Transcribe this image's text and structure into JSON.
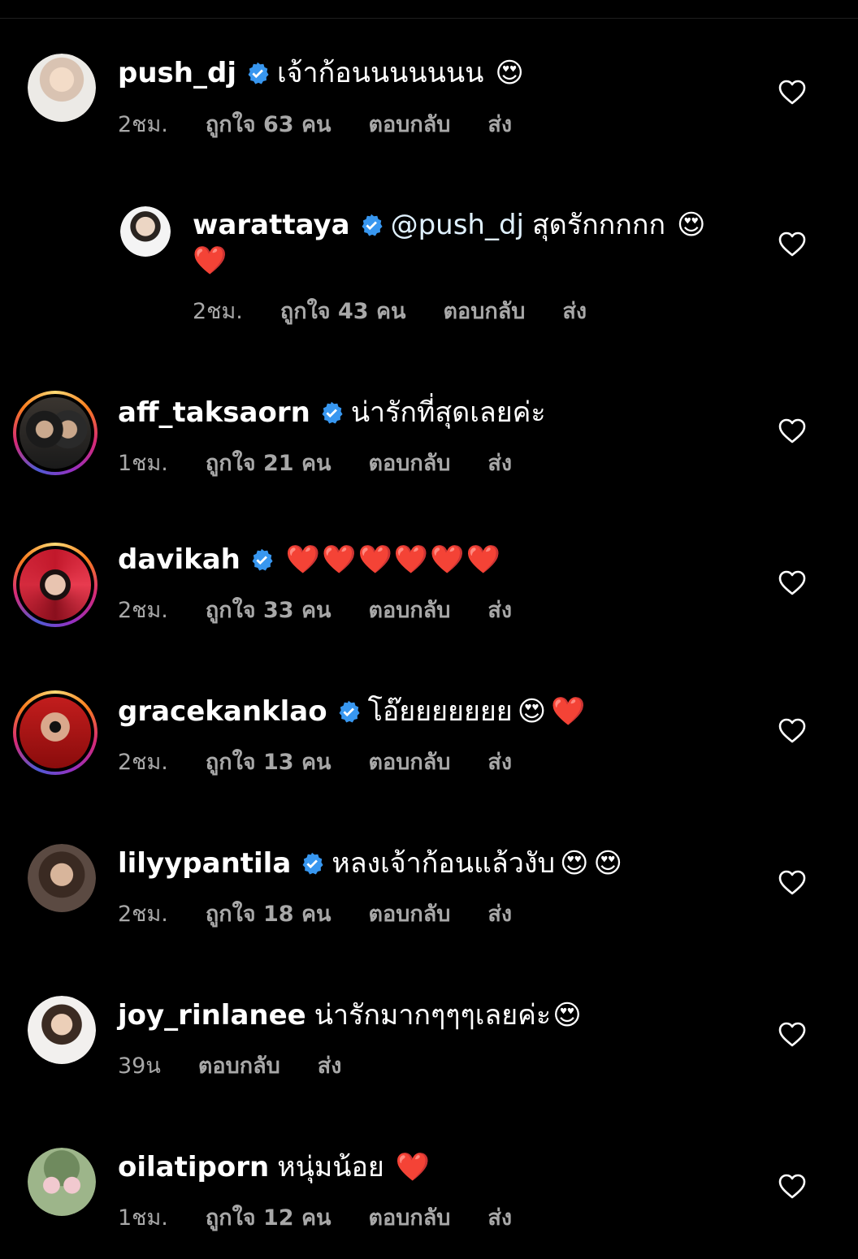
{
  "colors": {
    "background": "#000000",
    "text": "#ffffff",
    "muted": "#a8a8a8",
    "verified": "#3897f0"
  },
  "comments": [
    {
      "username": "push_dj",
      "verified": true,
      "text": "เจ้าก้อนนนนนนน",
      "emoji": "😍",
      "time": "2ชม.",
      "likes": "ถูกใจ 63 คน",
      "reply": "ตอบกลับ",
      "send": "ส่ง"
    },
    {
      "username": "warattaya",
      "verified": true,
      "mention": "@push_dj",
      "text": "สุดรักกกกก",
      "emoji": "😍",
      "emoji2": "❤️",
      "time": "2ชม.",
      "likes": "ถูกใจ 43 คน",
      "reply": "ตอบกลับ",
      "send": "ส่ง"
    },
    {
      "username": "aff_taksaorn",
      "verified": true,
      "text": "น่ารักที่สุดเลยค่ะ",
      "emoji": "",
      "time": "1ชม.",
      "likes": "ถูกใจ 21 คน",
      "reply": "ตอบกลับ",
      "send": "ส่ง"
    },
    {
      "username": "davikah",
      "verified": true,
      "text": "",
      "emoji": "❤️❤️❤️❤️❤️❤️",
      "time": "2ชม.",
      "likes": "ถูกใจ 33 คน",
      "reply": "ตอบกลับ",
      "send": "ส่ง"
    },
    {
      "username": "gracekanklao",
      "verified": true,
      "text": "โอ๊ยยยยยยย",
      "emoji": "😍❤️",
      "time": "2ชม.",
      "likes": "ถูกใจ 13 คน",
      "reply": "ตอบกลับ",
      "send": "ส่ง"
    },
    {
      "username": "lilyypantila",
      "verified": true,
      "text": "หลงเจ้าก้อนแล้วงับ",
      "emoji": "😍😍",
      "time": "2ชม.",
      "likes": "ถูกใจ 18 คน",
      "reply": "ตอบกลับ",
      "send": "ส่ง"
    },
    {
      "username": "joy_rinlanee",
      "verified": false,
      "text": "น่ารักมากๆๆๆเลยค่ะ",
      "emoji": "😍",
      "time": "39น",
      "likes": "",
      "reply": "ตอบกลับ",
      "send": "ส่ง"
    },
    {
      "username": "oilatiporn",
      "verified": false,
      "text": "หนุ่มน้อย",
      "emoji": "❤️",
      "time": "1ชม.",
      "likes": "ถูกใจ 12 คน",
      "reply": "ตอบกลับ",
      "send": "ส่ง"
    }
  ]
}
